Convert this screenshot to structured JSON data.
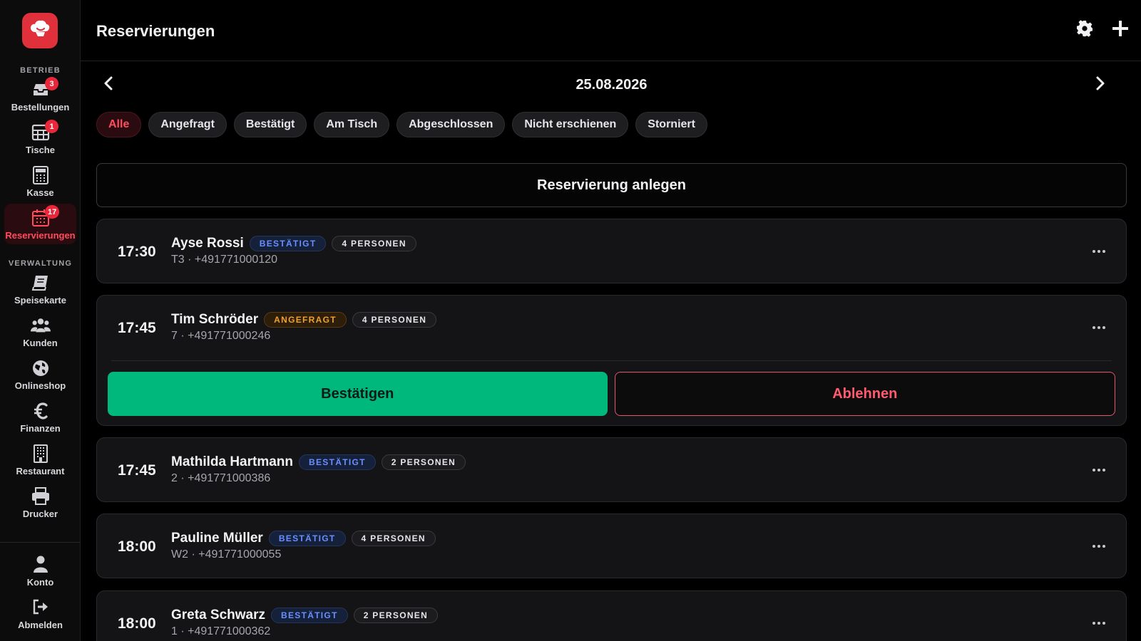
{
  "app": {
    "logo_icon": "chef-hat-icon",
    "accent": "#e0303c"
  },
  "sidebar": {
    "sections": [
      {
        "label": "BETRIEB"
      },
      {
        "label": "VERWALTUNG"
      }
    ],
    "items": [
      {
        "label": "Bestellungen",
        "icon": "inbox-icon",
        "badge": "3"
      },
      {
        "label": "Tische",
        "icon": "table-grid-icon",
        "badge": "1"
      },
      {
        "label": "Kasse",
        "icon": "calculator-icon",
        "badge": null
      },
      {
        "label": "Reservierungen",
        "icon": "calendar-icon",
        "badge": "17",
        "active": true
      },
      {
        "label": "Speisekarte",
        "icon": "book-icon",
        "badge": null
      },
      {
        "label": "Kunden",
        "icon": "users-icon",
        "badge": null
      },
      {
        "label": "Onlineshop",
        "icon": "globe-icon",
        "badge": null
      },
      {
        "label": "Finanzen",
        "icon": "euro-icon",
        "badge": null
      },
      {
        "label": "Restaurant",
        "icon": "building-icon",
        "badge": null
      },
      {
        "label": "Drucker",
        "icon": "printer-icon",
        "badge": null
      }
    ],
    "footer": [
      {
        "label": "Konto",
        "icon": "user-icon"
      },
      {
        "label": "Abmelden",
        "icon": "logout-icon"
      }
    ]
  },
  "header": {
    "title": "Reservierungen",
    "settings_icon": "gear-icon",
    "add_icon": "plus-icon"
  },
  "date_nav": {
    "date": "25.08.2026"
  },
  "filters": [
    {
      "label": "Alle",
      "active": true
    },
    {
      "label": "Angefragt"
    },
    {
      "label": "Bestätigt"
    },
    {
      "label": "Am Tisch"
    },
    {
      "label": "Abgeschlossen"
    },
    {
      "label": "Nicht erschienen"
    },
    {
      "label": "Storniert"
    }
  ],
  "create_button": "Reservierung anlegen",
  "reservations": [
    {
      "time": "17:30",
      "name": "Ayse Rossi",
      "status": "BESTÄTIGT",
      "persons": "4 PERSONEN",
      "sub": "T3 · +491771000120"
    },
    {
      "time": "17:45",
      "name": "Tim Schröder",
      "status": "ANGEFRAGT",
      "persons": "4 PERSONEN",
      "sub": "7 · +491771000246"
    },
    {
      "time": "17:45",
      "name": "Mathilda Hartmann",
      "status": "BESTÄTIGT",
      "persons": "2 PERSONEN",
      "sub": "2 · +491771000386"
    },
    {
      "time": "18:00",
      "name": "Pauline Müller",
      "status": "BESTÄTIGT",
      "persons": "4 PERSONEN",
      "sub": "W2 · +491771000055"
    },
    {
      "time": "18:00",
      "name": "Greta Schwarz",
      "status": "BESTÄTIGT",
      "persons": "2 PERSONEN",
      "sub": "1 · +491771000362"
    }
  ],
  "actions": {
    "confirm": "Bestätigen",
    "reject": "Ablehnen"
  },
  "colors": {
    "confirmed": "#6a8fff",
    "requested": "#f1a12c",
    "confirm_button": "#00b77c",
    "reject": "#ff5a6e"
  }
}
